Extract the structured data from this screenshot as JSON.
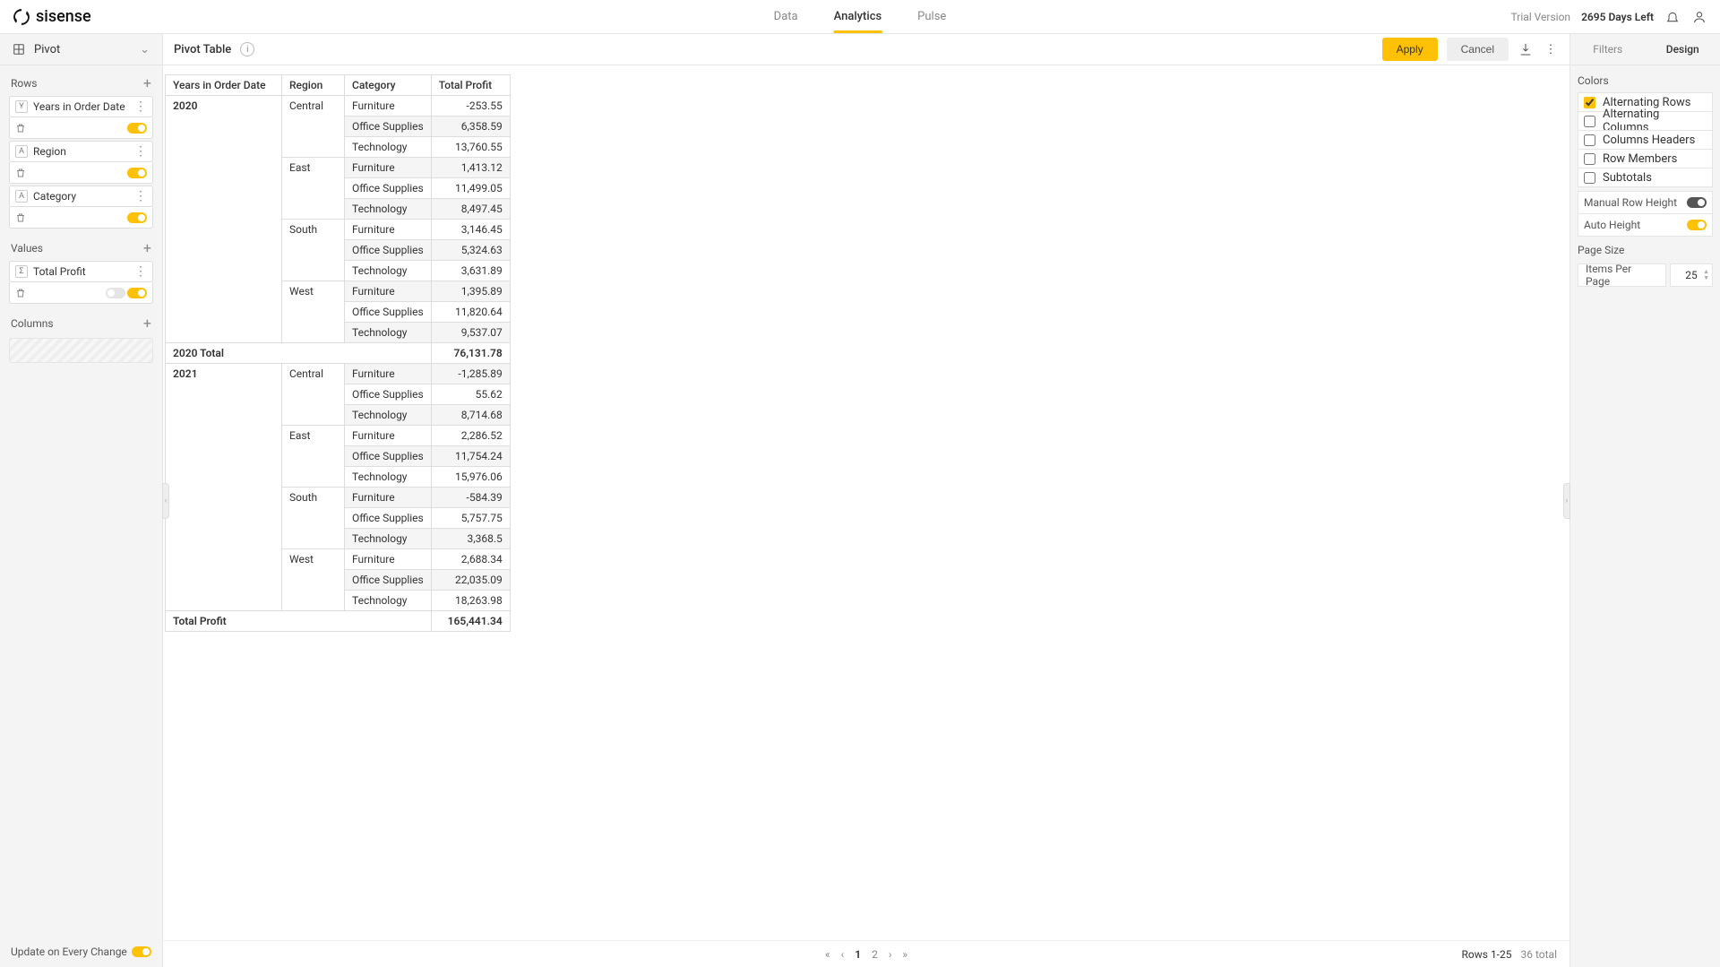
{
  "header": {
    "brand": "sisense",
    "nav": [
      "Data",
      "Analytics",
      "Pulse"
    ],
    "active_nav": 1,
    "trial_label": "Trial Version",
    "days_left": "2695 Days Left"
  },
  "left": {
    "widget_type": "Pivot",
    "sections": {
      "rows": {
        "title": "Rows",
        "items": [
          {
            "tag": "Y",
            "label": "Years in Order Date"
          },
          {
            "tag": "A",
            "label": "Region"
          },
          {
            "tag": "A",
            "label": "Category"
          }
        ]
      },
      "values": {
        "title": "Values",
        "items": [
          {
            "tag": "Σ",
            "label": "Total Profit"
          }
        ]
      },
      "columns": {
        "title": "Columns"
      }
    },
    "update_label": "Update on Every Change"
  },
  "toolbar": {
    "title": "Pivot Table",
    "apply": "Apply",
    "cancel": "Cancel"
  },
  "pivot": {
    "headers": [
      "Years in Order Date",
      "Region",
      "Category",
      "Total Profit"
    ],
    "groups": [
      {
        "year": "2020",
        "regions": [
          {
            "name": "Central",
            "rows": [
              {
                "cat": "Furniture",
                "val": "-253.55"
              },
              {
                "cat": "Office Supplies",
                "val": "6,358.59"
              },
              {
                "cat": "Technology",
                "val": "13,760.55"
              }
            ]
          },
          {
            "name": "East",
            "rows": [
              {
                "cat": "Furniture",
                "val": "1,413.12"
              },
              {
                "cat": "Office Supplies",
                "val": "11,499.05"
              },
              {
                "cat": "Technology",
                "val": "8,497.45"
              }
            ]
          },
          {
            "name": "South",
            "rows": [
              {
                "cat": "Furniture",
                "val": "3,146.45"
              },
              {
                "cat": "Office Supplies",
                "val": "5,324.63"
              },
              {
                "cat": "Technology",
                "val": "3,631.89"
              }
            ]
          },
          {
            "name": "West",
            "rows": [
              {
                "cat": "Furniture",
                "val": "1,395.89"
              },
              {
                "cat": "Office Supplies",
                "val": "11,820.64"
              },
              {
                "cat": "Technology",
                "val": "9,537.07"
              }
            ]
          }
        ],
        "subtotal": {
          "label": "2020 Total",
          "val": "76,131.78"
        }
      },
      {
        "year": "2021",
        "regions": [
          {
            "name": "Central",
            "rows": [
              {
                "cat": "Furniture",
                "val": "-1,285.89"
              },
              {
                "cat": "Office Supplies",
                "val": "55.62"
              },
              {
                "cat": "Technology",
                "val": "8,714.68"
              }
            ]
          },
          {
            "name": "East",
            "rows": [
              {
                "cat": "Furniture",
                "val": "2,286.52"
              },
              {
                "cat": "Office Supplies",
                "val": "11,754.24"
              },
              {
                "cat": "Technology",
                "val": "15,976.06"
              }
            ]
          },
          {
            "name": "South",
            "rows": [
              {
                "cat": "Furniture",
                "val": "-584.39"
              },
              {
                "cat": "Office Supplies",
                "val": "5,757.75"
              },
              {
                "cat": "Technology",
                "val": "3,368.5"
              }
            ]
          },
          {
            "name": "West",
            "rows": [
              {
                "cat": "Furniture",
                "val": "2,688.34"
              },
              {
                "cat": "Office Supplies",
                "val": "22,035.09"
              },
              {
                "cat": "Technology",
                "val": "18,263.98"
              }
            ]
          }
        ]
      }
    ],
    "grand": {
      "label": "Total Profit",
      "val": "165,441.34"
    }
  },
  "pager": {
    "pages": [
      "1",
      "2"
    ],
    "active": 0,
    "rows_label": "Rows 1-25",
    "total_label": "36 total"
  },
  "right": {
    "tabs": [
      "Filters",
      "Design"
    ],
    "active_tab": 1,
    "colors_title": "Colors",
    "checks": [
      {
        "label": "Alternating Rows",
        "on": true
      },
      {
        "label": "Alternating Columns",
        "on": false
      },
      {
        "label": "Columns Headers",
        "on": false
      },
      {
        "label": "Row Members",
        "on": false
      },
      {
        "label": "Subtotals",
        "on": false
      }
    ],
    "manual_row": "Manual Row Height",
    "auto_height": "Auto Height",
    "page_size": "Page Size",
    "items_label": "Items Per Page",
    "items_value": "25"
  }
}
